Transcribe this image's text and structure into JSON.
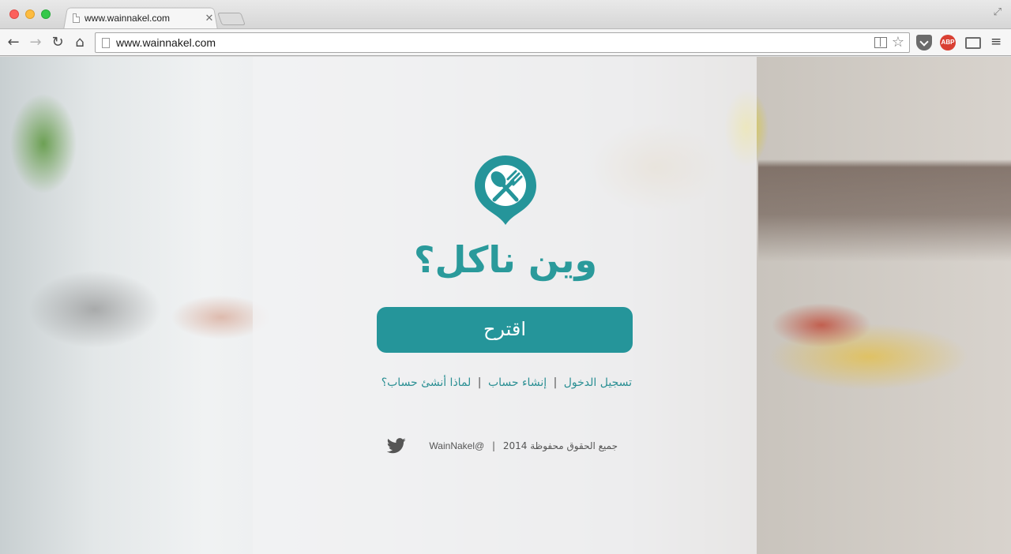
{
  "browser": {
    "tab_title": "www.wainnakel.com",
    "tab_close": "✕",
    "url": "www.wainnakel.com",
    "extensions": {
      "abp_label": "ABP"
    }
  },
  "page": {
    "brand_title": "وين ناكل؟",
    "suggest_button": "اقترح",
    "links": {
      "login": "تسجيل الدخول",
      "separator": "|",
      "register": "إنشاء حساب",
      "why_register": "لماذا أنشئ حساب؟"
    },
    "footer": {
      "copyright": "جميع الحقوق محفوظة 2014",
      "separator": "|",
      "twitter_handle": "@WainNakel"
    },
    "colors": {
      "accent": "#25959a",
      "title": "#2a9a9b"
    }
  }
}
